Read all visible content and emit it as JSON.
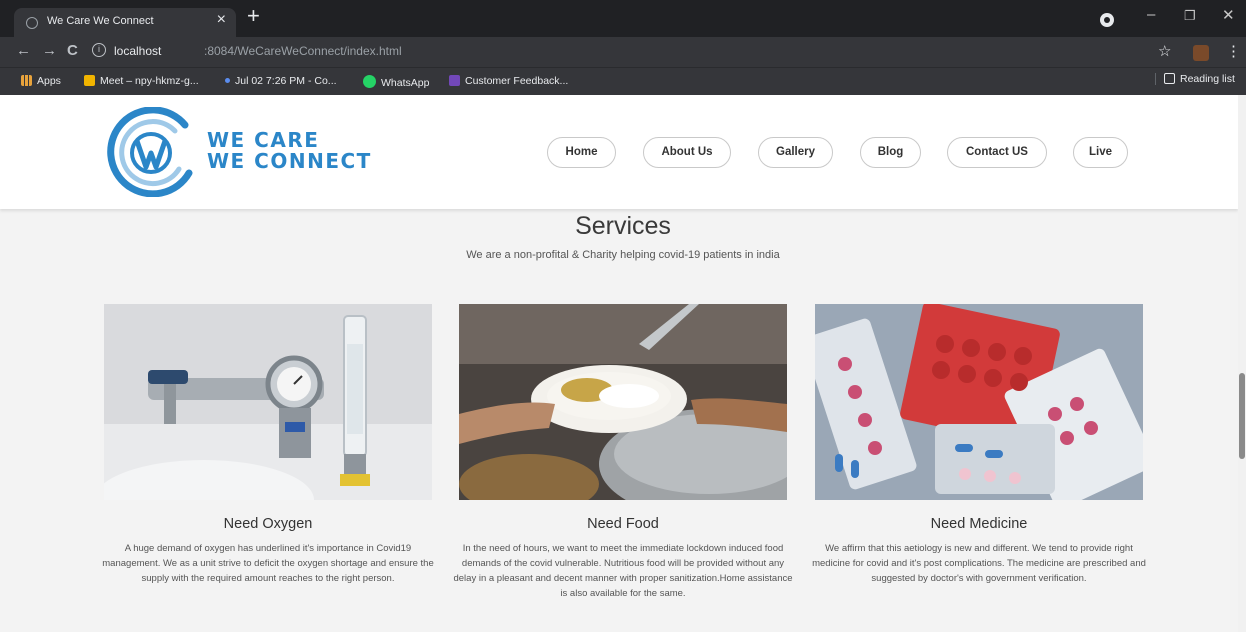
{
  "browser": {
    "tab_title": "We Care We Connect",
    "tab_close": "×",
    "new_tab": "+",
    "url_host": "localhost",
    "url_rest": ":8084/WeCareWeConnect/index.html",
    "bookmarks": [
      {
        "label": "Apps",
        "icon": "apps-grid-icon",
        "color": "#e8a33c"
      },
      {
        "label": "Meet – npy-hkmz-g...",
        "icon": "meet-icon",
        "color": "#f1b400"
      },
      {
        "label": "Jul 02 7:26 PM - Co...",
        "icon": "dot-icon",
        "color": "#5b8def"
      },
      {
        "label": "WhatsApp",
        "icon": "whatsapp-icon",
        "color": "#25d366"
      },
      {
        "label": "Customer Feedback...",
        "icon": "forms-icon",
        "color": "#7248b9"
      }
    ],
    "reading_list": "Reading list"
  },
  "site": {
    "logo_line1": "WE CARE",
    "logo_line2": "WE CONNECT",
    "nav": [
      "Home",
      "About Us",
      "Gallery",
      "Blog",
      "Contact US",
      "Live"
    ],
    "accent_color": "#2b86c8"
  },
  "services": {
    "title": "Services",
    "subtitle": "We are a non-profital & Charity helping covid-19 patients in india",
    "cards": [
      {
        "title": "Need Oxygen",
        "image": "oxygen-cylinder-regulator",
        "text": "A huge demand of oxygen has underlined it's importance in Covid19 management. We as a unit strive to deficit the oxygen shortage and ensure the supply with the required amount reaches to the right person."
      },
      {
        "title": "Need Food",
        "image": "food-plate-serving",
        "text": "In the need of hours, we want to meet the immediate lockdown induced food demands of the covid vulnerable. Nutritious food will be provided without any delay in a pleasant and decent manner with proper sanitization.Home assistance is also available for the same."
      },
      {
        "title": "Need Medicine",
        "image": "medicine-blister-packs",
        "text": "We affirm that this aetiology is new and different. We tend to provide right medicine for covid and it's post complications. The medicine are prescribed and suggested by doctor's with government verification."
      }
    ]
  }
}
